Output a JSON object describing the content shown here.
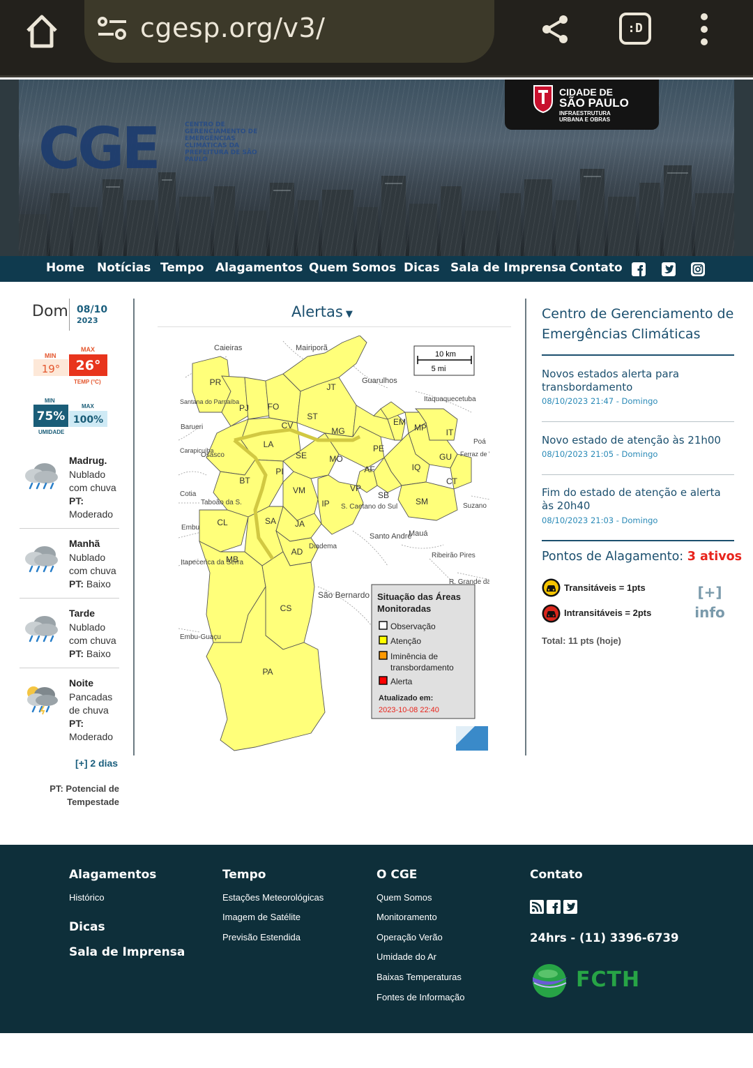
{
  "browser": {
    "url": "cgesp.org/v3/",
    "tab_label": ":D"
  },
  "banner": {
    "logo_text": "CGE",
    "logo_subtitle": "Centro de Gerenciamento de Emergências Climáticas da Prefeitura de São Paulo",
    "city_line1": "CIDADE DE",
    "city_line2": "SÃO PAULO",
    "city_line3": "INFRAESTRUTURA",
    "city_line4": "URBANA E OBRAS"
  },
  "nav": {
    "items": [
      "Home",
      "Notícias",
      "Tempo",
      "Alagamentos",
      "Quem Somos",
      "Dicas",
      "Sala de Imprensa",
      "Contato"
    ],
    "social_icons": [
      "facebook-icon",
      "twitter-icon",
      "instagram-icon"
    ]
  },
  "weather": {
    "day": "Dom",
    "date_main": "08/10",
    "date_year": "2023",
    "temp": {
      "min_label": "MIN",
      "max_label": "MAX",
      "min": "19°",
      "max": "26°",
      "unit_label": "TEMP (°C)"
    },
    "humidity": {
      "min_label": "MIN",
      "max_label": "MAX",
      "min": "75%",
      "max": "100%",
      "unit_label": "UMIDADE"
    },
    "periods": [
      {
        "name": "Madrug.",
        "desc": "Nublado com chuva",
        "pt_label": "PT:",
        "pt": "Moderado",
        "icon": "cloud-rain-icon"
      },
      {
        "name": "Manhã",
        "desc": "Nublado com chuva",
        "pt_label": "PT:",
        "pt": "Baixo",
        "icon": "cloud-rain-icon"
      },
      {
        "name": "Tarde",
        "desc": "Nublado com chuva",
        "pt_label": "PT:",
        "pt": "Baixo",
        "icon": "cloud-rain-icon"
      },
      {
        "name": "Noite",
        "desc": "Pancadas de chuva",
        "pt_label": "PT:",
        "pt": "Moderado",
        "icon": "cloud-sun-rain-icon"
      }
    ],
    "more_days": "[+] 2 dias",
    "pt_legend": "PT: Potencial de Tempestade"
  },
  "alerts": {
    "title": "Alertas",
    "scale_km": "10 km",
    "scale_mi": "5 mi",
    "regions": [
      "PR",
      "PJ",
      "FO",
      "ST",
      "JT",
      "CV",
      "MG",
      "LA",
      "SE",
      "MO",
      "PE",
      "EM",
      "MP",
      "IT",
      "GU",
      "IQ",
      "CT",
      "AF",
      "BT",
      "PI",
      "VM",
      "VP",
      "SB",
      "SM",
      "IP",
      "CL",
      "SA",
      "JA",
      "AD",
      "MB",
      "CS",
      "PA"
    ],
    "places": [
      "Caieiras",
      "Mairiporã",
      "Guarulhos",
      "Itaquaquecetuba",
      "Santana do Parnaíba",
      "Barueri",
      "Osasco",
      "Carapicuíba",
      "Cotia",
      "Taboão da S.",
      "Embu",
      "Itapecerica da Serra",
      "Embu-Guaçu",
      "S. Caetano do Sul",
      "Santo André",
      "Mauá",
      "Ribeirão Pires",
      "Diadema",
      "São Bernardo do Campo",
      "Poá",
      "Ferraz de V.",
      "Suzano",
      "R. Grande da Serra"
    ],
    "legend": {
      "title": "Situação das Áreas Monitoradas",
      "items": [
        {
          "label": "Observação",
          "color": "#ffffff"
        },
        {
          "label": "Atenção",
          "color": "#ffff00"
        },
        {
          "label": "Iminência de transbordamento",
          "color": "#ff9900"
        },
        {
          "label": "Alerta",
          "color": "#ff0000"
        }
      ],
      "updated_label": "Atualizado em:",
      "updated": "2023-10-08 22:40"
    }
  },
  "right": {
    "title": "Centro de Gerenciamento de Emergências Climáticas",
    "news": [
      {
        "title": "Novos estados alerta para transbordamento",
        "date": "08/10/2023 21:47 - Domingo"
      },
      {
        "title": "Novo estado de atenção às 21h00",
        "date": "08/10/2023 21:05 - Domingo"
      },
      {
        "title": "Fim do estado de atenção e alerta às 20h40",
        "date": "08/10/2023 21:03 - Domingo"
      }
    ],
    "flood": {
      "title": "Pontos de Alagamento:",
      "count": "3 ativos",
      "transit": "Transitáveis = 1pts",
      "intransit": "Intransitáveis = 2pts",
      "info_line1": "[+]",
      "info_line2": "info",
      "total": "Total: 11 pts (hoje)",
      "transit_color": "#f5c400",
      "intransit_color": "#d9261c"
    }
  },
  "footer": {
    "col1": {
      "heading": "Alagamentos",
      "links": [
        "Histórico"
      ],
      "heading2": "Dicas",
      "heading3": "Sala de Imprensa"
    },
    "col2": {
      "heading": "Tempo",
      "links": [
        "Estações Meteorológicas",
        "Imagem de Satélite",
        "Previsão Estendida"
      ]
    },
    "col3": {
      "heading": "O CGE",
      "links": [
        "Quem Somos",
        "Monitoramento",
        "Operação Verão",
        "Umidade do Ar",
        "Baixas Temperaturas",
        "Fontes de Informação"
      ]
    },
    "col4": {
      "heading": "Contato",
      "phone": "24hrs - (11) 3396-6739",
      "partner": "FCTH"
    }
  }
}
